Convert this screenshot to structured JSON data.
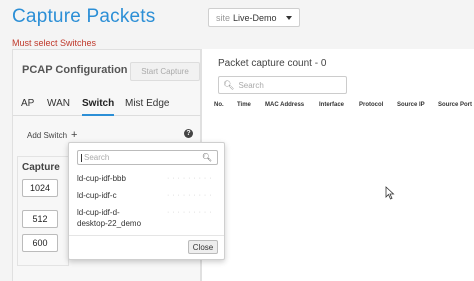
{
  "header": {
    "title": "Capture Packets",
    "site_prefix": "site",
    "site_value": "Live-Demo",
    "error": "Must select Switches"
  },
  "left": {
    "pcap_title": "PCAP Configuration",
    "start_label": "Start Capture",
    "tabs": [
      {
        "label": "AP"
      },
      {
        "label": "WAN"
      },
      {
        "label": "Switch",
        "active": true
      },
      {
        "label": "Mist Edge"
      }
    ],
    "add_switch": "Add Switch",
    "plus": "+",
    "help": "?",
    "capture": {
      "label": "Capture",
      "values": [
        "1024",
        "512",
        "600"
      ]
    }
  },
  "right": {
    "count_label": "Packet capture count - 0",
    "search_placeholder": "Search",
    "columns": [
      "No.",
      "Time",
      "MAC Address",
      "Interface",
      "Protocol",
      "Source IP",
      "Source Port"
    ]
  },
  "popup": {
    "search_placeholder": "Search",
    "items": [
      {
        "name": "ld-cup-idf-bbb",
        "mac": "· · · · · · · · ·"
      },
      {
        "name": "ld-cup-idf-c",
        "mac": "· · · · · · · · ·"
      },
      {
        "name_line1": "ld-cup-idf-d-",
        "name_line2": "desktop-22_demo",
        "mac": "· · · · · · · · ·"
      }
    ],
    "close_label": "Close"
  },
  "colors": {
    "accent": "#2c8fd6",
    "error": "#c0392b"
  }
}
